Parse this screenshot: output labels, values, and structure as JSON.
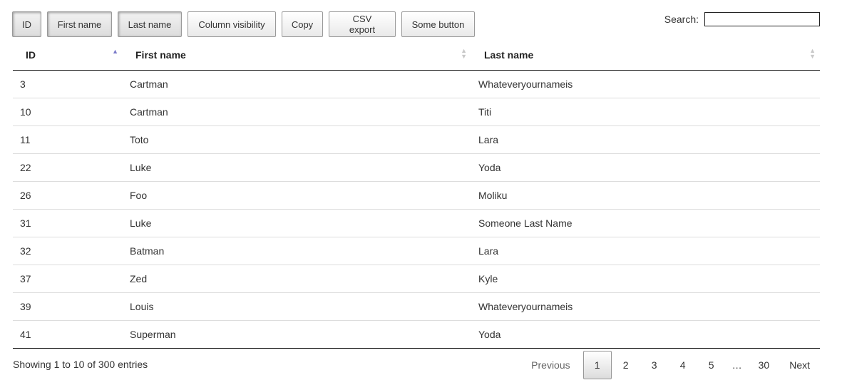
{
  "toolbar": {
    "buttons": [
      {
        "label": "ID",
        "active": true
      },
      {
        "label": "First name",
        "active": true
      },
      {
        "label": "Last name",
        "active": true
      },
      {
        "label": "Column visibility",
        "active": false
      },
      {
        "label": "Copy",
        "active": false
      },
      {
        "label": "CSV export",
        "active": false
      },
      {
        "label": "Some button",
        "active": false
      }
    ]
  },
  "search": {
    "label": "Search:",
    "value": "",
    "placeholder": ""
  },
  "table": {
    "columns": [
      {
        "label": "ID",
        "sort": "ascending"
      },
      {
        "label": "First name",
        "sort": "none"
      },
      {
        "label": "Last name",
        "sort": "none"
      }
    ],
    "rows": [
      [
        "3",
        "Cartman",
        "Whateveryournameis"
      ],
      [
        "10",
        "Cartman",
        "Titi"
      ],
      [
        "11",
        "Toto",
        "Lara"
      ],
      [
        "22",
        "Luke",
        "Yoda"
      ],
      [
        "26",
        "Foo",
        "Moliku"
      ],
      [
        "31",
        "Luke",
        "Someone Last Name"
      ],
      [
        "32",
        "Batman",
        "Lara"
      ],
      [
        "37",
        "Zed",
        "Kyle"
      ],
      [
        "39",
        "Louis",
        "Whateveryournameis"
      ],
      [
        "41",
        "Superman",
        "Yoda"
      ]
    ]
  },
  "info": "Showing 1 to 10 of 300 entries",
  "pagination": {
    "previous": "Previous",
    "next": "Next",
    "pages": [
      "1",
      "2",
      "3",
      "4",
      "5",
      "…",
      "30"
    ],
    "current": "1"
  },
  "colors": {
    "sort_active": "#7a7ac9",
    "sort_inactive": "#c8c8c8",
    "row_border": "#dddddd",
    "header_border": "#111111"
  }
}
